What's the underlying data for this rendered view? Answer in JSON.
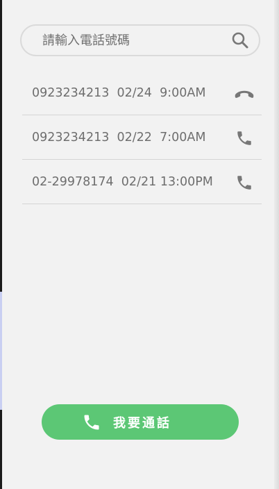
{
  "search": {
    "placeholder": "請輸入電話號碼",
    "icon": "search-icon"
  },
  "calls": [
    {
      "number": "0923234213",
      "date": "02/24",
      "time": "9:00AM",
      "status": "hang-up",
      "icon": "phone-hangup-icon"
    },
    {
      "number": "0923234213",
      "date": "02/22",
      "time": "7:00AM",
      "status": "call",
      "icon": "phone-icon"
    },
    {
      "number": "02-29978174",
      "date": "02/21",
      "time": "13:00PM",
      "status": "call",
      "icon": "phone-icon"
    }
  ],
  "call_button": {
    "label": "我要通話",
    "icon": "phone-icon"
  },
  "colors": {
    "background": "#f2f2f2",
    "text": "#6e6e6e",
    "icon": "#777777",
    "accent": "#5cc775"
  }
}
